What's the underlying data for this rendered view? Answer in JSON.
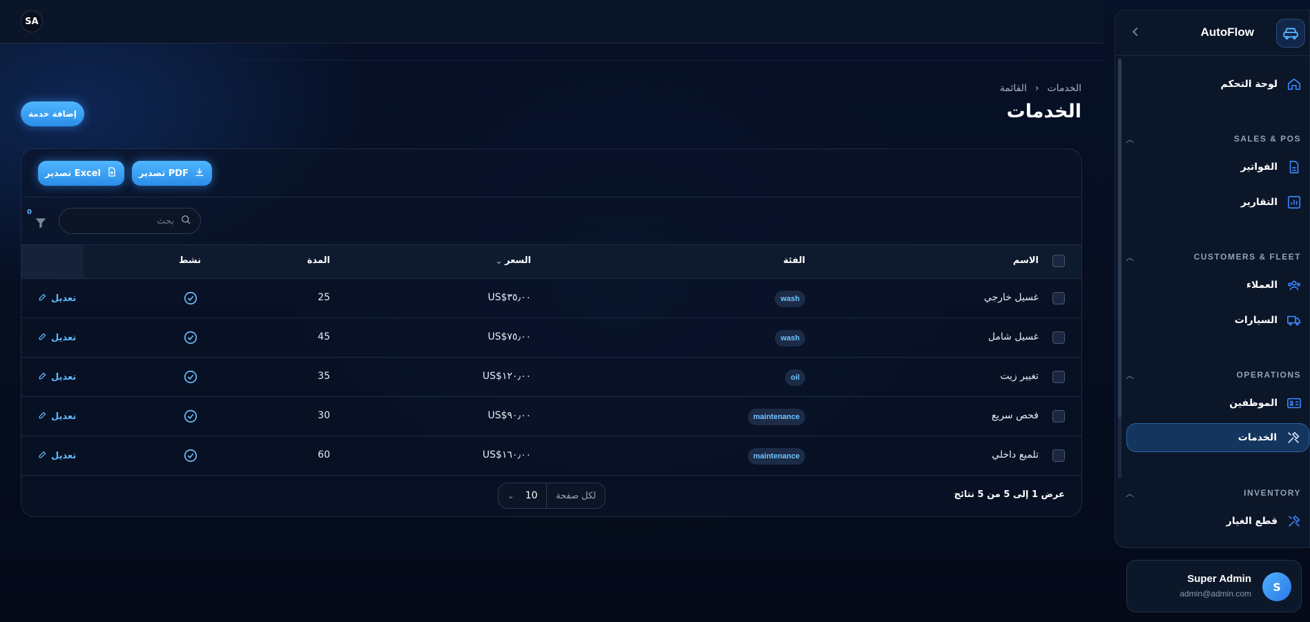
{
  "topbar": {
    "avatar_initials": "SA"
  },
  "sidebar": {
    "brand": "AutoFlow",
    "items": [
      {
        "label": "لوحة التحكم",
        "icon": "home-icon"
      }
    ],
    "sections": [
      {
        "title": "SALES & POS",
        "items": [
          {
            "label": "الفواتير",
            "icon": "file-icon"
          },
          {
            "label": "التقارير",
            "icon": "chart-icon"
          }
        ]
      },
      {
        "title": "CUSTOMERS & FLEET",
        "items": [
          {
            "label": "العملاء",
            "icon": "users-icon"
          },
          {
            "label": "السيارات",
            "icon": "truck-icon"
          }
        ]
      },
      {
        "title": "OPERATIONS",
        "items": [
          {
            "label": "الموظفين",
            "icon": "id-card-icon"
          },
          {
            "label": "الخدمات",
            "icon": "tools-icon",
            "active": true
          }
        ]
      },
      {
        "title": "INVENTORY",
        "items": [
          {
            "label": "قطع الغيار",
            "icon": "tools-icon"
          }
        ]
      }
    ],
    "user": {
      "name": "Super Admin",
      "email": "admin@admin.com",
      "initial": "S"
    }
  },
  "breadcrumb": {
    "root": "الخدمات",
    "current": "القائمة"
  },
  "page": {
    "title": "الخدمات",
    "add_button": "إضافة خدمة"
  },
  "toolbar": {
    "export_pdf": "تصدير PDF",
    "export_excel": "تصدير Excel"
  },
  "filter": {
    "count": "0",
    "search_placeholder": "بحث"
  },
  "table": {
    "headers": {
      "name": "الاسم",
      "category": "الفئة",
      "price": "السعر",
      "duration": "المدة",
      "active": "نشط"
    },
    "edit_label": "تعديل",
    "rows": [
      {
        "name": "غسيل خارجي",
        "category": "wash",
        "price": "US$٣٥٫٠٠",
        "duration": "25"
      },
      {
        "name": "غسيل شامل",
        "category": "wash",
        "price": "US$٧٥٫٠٠",
        "duration": "45"
      },
      {
        "name": "تغيير زيت",
        "category": "oil",
        "price": "US$١٢٠٫٠٠",
        "duration": "35"
      },
      {
        "name": "فحص سريع",
        "category": "maintenance",
        "price": "US$٩٠٫٠٠",
        "duration": "30"
      },
      {
        "name": "تلميع داخلي",
        "category": "maintenance",
        "price": "US$١٦٠٫٠٠",
        "duration": "60"
      }
    ]
  },
  "footer": {
    "results": "عرض 1 إلى 5 من 5 نتائج",
    "per_page_label": "لكل صفحة",
    "per_page_value": "10"
  },
  "colors": {
    "accent": "#3a8ff0",
    "badge_text": "#6fc3ff",
    "background": "#050d1f"
  }
}
